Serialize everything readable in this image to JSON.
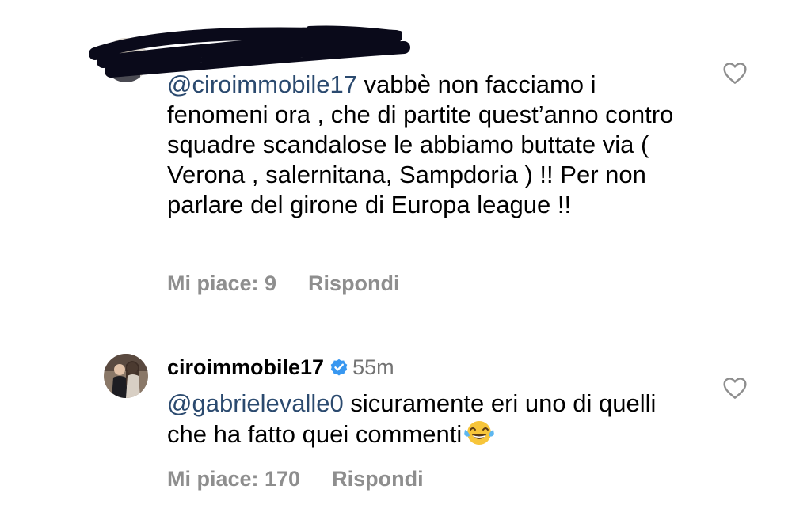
{
  "comments": [
    {
      "mention": "@ciroimmobile17",
      "body": " vabbè non facciamo i fenomeni ora , che di partite quest’anno contro squadre scandalose le abbiamo buttate via ( Verona , salernitana, Sampdoria ) !! Per non parlare del girone di Europa league !!",
      "likes_label": "Mi piace: 9",
      "reply_label": "Rispondi"
    },
    {
      "username": "ciroimmobile17",
      "time": "55m",
      "mention": "@gabrielevalle0",
      "body": " sicuramente eri uno di quelli che ha fatto quei commenti",
      "likes_label": "Mi piace: 170",
      "reply_label": "Rispondi"
    }
  ],
  "icons": {
    "like": "heart-outline-icon",
    "verified": "verified-badge-icon",
    "emoji": "face-with-tears-of-joy"
  },
  "colors": {
    "mention": "#2b4a6f",
    "secondary_text": "#8e8e8e",
    "verified": "#3897f0"
  }
}
